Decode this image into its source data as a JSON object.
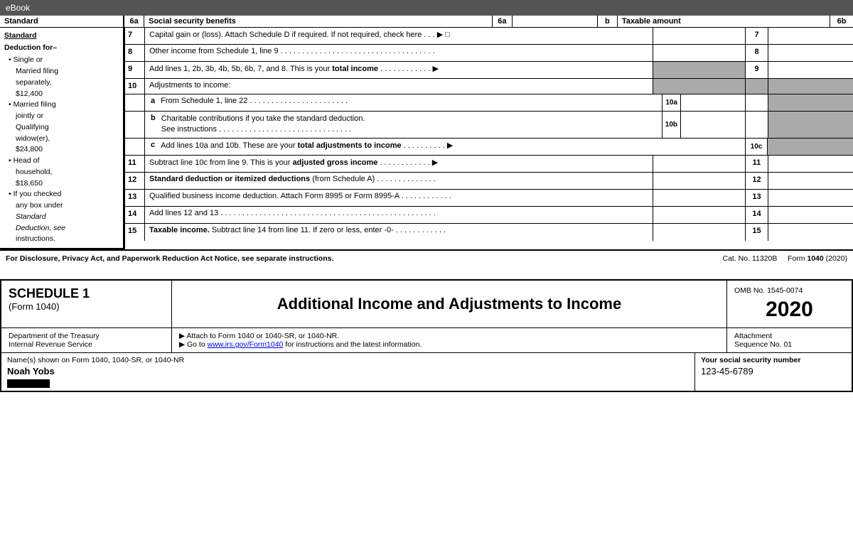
{
  "ebook_bar": {
    "label": "eBook"
  },
  "top_partial": {
    "col1_label": "Standard",
    "col2_label": "6a",
    "col2_text": "Social security benefits",
    "col3_label": "6a",
    "col4_label": "b",
    "col4_text": "Taxable amount",
    "col5_label": "6b"
  },
  "sidebar": {
    "title": "Standard",
    "deduction_title": "Deduction for–",
    "items": [
      "Single or",
      "Married filing",
      "separately,",
      "$12,400",
      "Married filing",
      "jointly or",
      "Qualifying",
      "widow(er),",
      "$24,800",
      "Head of",
      "household,",
      "$18,650",
      "If you checked",
      "any box under",
      "Standard",
      "Deduction, see",
      "instructions."
    ]
  },
  "lines": {
    "line7": {
      "num": "7",
      "desc": "Capital gain or (loss). Attach Schedule D if required. If not required, check here . . . ▶ □",
      "right_num": "7"
    },
    "line8": {
      "num": "8",
      "desc": "Other income from Schedule 1, line 9 . . . . . . . . . . . . . . . . . . . . . . . . . . . . . . . . . . . .",
      "right_num": "8"
    },
    "line9": {
      "num": "9",
      "desc": "Add lines 1, 2b, 3b, 4b, 5b, 6b, 7, and 8. This is your",
      "desc_bold": "total income",
      "desc_end": " . . . . . . . . . . . . ▶",
      "right_num": "9"
    },
    "line10_header": {
      "num": "10",
      "desc": "Adjustments to income:"
    },
    "line10a": {
      "label": "a",
      "desc": "From Schedule 1, line 22 . . . . . . . . . . . . . . . . . . . . . . .",
      "box_label": "10a"
    },
    "line10b": {
      "label": "b",
      "desc": "Charitable contributions if you take the standard deduction.",
      "desc2": "See instructions . . . . . . . . . . . . . . . . . . . . . . . . . . . . . . .",
      "box_label": "10b"
    },
    "line10c": {
      "label": "c",
      "desc": "Add lines 10a and 10b. These are your",
      "desc_bold": "total adjustments to income",
      "desc_end": " . . . . . . . . . . ▶",
      "box_label": "10c"
    },
    "line11": {
      "num": "11",
      "desc": "Subtract line 10c from line 9. This is your",
      "desc_bold": "adjusted gross income",
      "desc_end": " . . . . . . . . . . . . ▶",
      "right_num": "11"
    },
    "line12": {
      "num": "12",
      "desc_bold": "Standard deduction or itemized deductions",
      "desc_end": " (from Schedule A) . . . . . . . . . . . . . .",
      "right_num": "12"
    },
    "line13": {
      "num": "13",
      "desc": "Qualified business income deduction. Attach Form 8995 or Form 8995-A . . . . . . . . . . . .",
      "right_num": "13"
    },
    "line14": {
      "num": "14",
      "desc": "Add lines 12 and 13 . . . . . . . . . . . . . . . . . . . . . . . . . . . . . . . . . . . . . . . . . . . . . . . . . .",
      "right_num": "14"
    },
    "line15": {
      "num": "15",
      "desc_bold": "Taxable income.",
      "desc_end": " Subtract line 14 from line 11. If zero or less, enter -0- . . . . . . . . . . . .",
      "right_num": "15"
    }
  },
  "footer": {
    "left": "For Disclosure, Privacy Act, and Paperwork Reduction Act Notice, see separate instructions.",
    "middle": "Cat. No. 11320B",
    "right": "Form 1040 (2020)"
  },
  "schedule1": {
    "left_title": "SCHEDULE 1",
    "left_subtitle": "(Form 1040)",
    "center_title": "Additional Income and Adjustments to Income",
    "right_omb": "OMB No. 1545-0074",
    "right_year": "2020",
    "instr_center1": "▶ Attach to Form 1040 or 1040-SR, or 1040-NR.",
    "instr_center2": "▶ Go to",
    "instr_center_link": "www.irs.gov/Form1040",
    "instr_center3": "for instructions and the latest information.",
    "instr_right1": "Attachment",
    "instr_right2": "Sequence No. 01",
    "name_label": "Name(s) shown on Form 1040, 1040-SR, or 1040-NR",
    "name_value": "Noah Yobs",
    "ssn_label": "Your social security number",
    "ssn_value": "123-45-6789"
  }
}
